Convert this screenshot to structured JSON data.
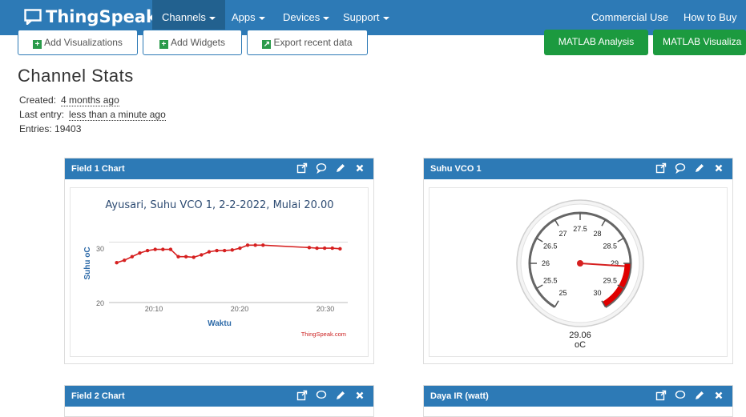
{
  "nav": {
    "brand": "ThingSpeak",
    "tm": "™",
    "items": [
      "Channels",
      "Apps",
      "Devices",
      "Support"
    ],
    "right_items": [
      "Commercial Use",
      "How to Buy"
    ]
  },
  "toolbar": {
    "add_visualizations": "Add Visualizations",
    "add_widgets": "Add Widgets",
    "export_data": "Export recent data",
    "matlab_analysis": "MATLAB Analysis",
    "matlab_visualization": "MATLAB Visualiza"
  },
  "stats": {
    "title": "Channel Stats",
    "created_label": "Created:",
    "created_value": "4 months ago",
    "last_entry_label": "Last entry:",
    "last_entry_value": "less than a minute ago",
    "entries_label": "Entries:",
    "entries_value": "19403"
  },
  "panels": {
    "field1": {
      "title": "Field 1 Chart",
      "chart_title": "Ayusari, Suhu VCO 1, 2-2-2022, Mulai 20.00",
      "ylabel": "Suhu oC",
      "xlabel": "Waktu",
      "credit": "ThingSpeak.com",
      "yticks": [
        "30",
        "20"
      ],
      "xticks": [
        "20:10",
        "20:20",
        "20:30"
      ]
    },
    "gauge1": {
      "title": "Suhu VCO 1",
      "value": "29.06",
      "unit": "oC",
      "ticks": [
        "25",
        "25.5",
        "26",
        "26.5",
        "27",
        "27.5",
        "28",
        "28.5",
        "29",
        "29.5",
        "30"
      ]
    },
    "field2": {
      "title": "Field 2 Chart"
    },
    "daya": {
      "title": "Daya IR (watt)"
    }
  },
  "chart_data": {
    "type": "line",
    "title": "Ayusari, Suhu VCO 1, 2-2-2022, Mulai 20:00",
    "xlabel": "Waktu",
    "ylabel": "Suhu oC",
    "ylim": [
      20,
      31
    ],
    "x": [
      "20:03",
      "20:04",
      "20:05",
      "20:06",
      "20:07",
      "20:08",
      "20:09",
      "20:10",
      "20:11",
      "20:12",
      "20:13",
      "20:14",
      "20:15",
      "20:16",
      "20:17",
      "20:18",
      "20:19",
      "20:20",
      "20:21",
      "20:22",
      "20:28",
      "20:29",
      "20:30",
      "20:31",
      "20:32"
    ],
    "series": [
      {
        "values": [
          26.6,
          27.0,
          27.6,
          28.2,
          28.6,
          28.8,
          28.8,
          28.8,
          27.6,
          27.6,
          27.5,
          27.9,
          28.4,
          28.6,
          28.6,
          28.7,
          29.0,
          29.5,
          29.5,
          29.5,
          29.1,
          29.0,
          29.0,
          29.0,
          28.9
        ]
      }
    ],
    "grid": true
  },
  "gauge_data": {
    "min": 25,
    "max": 30,
    "value": 29.06,
    "red_from": 29,
    "red_to": 30
  }
}
